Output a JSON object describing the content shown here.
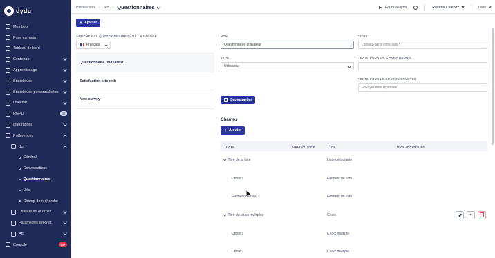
{
  "app": {
    "logo_text": "dydu"
  },
  "sidebar": {
    "items": [
      {
        "label": "Mes bots"
      },
      {
        "label": "Prise en main"
      },
      {
        "label": "Tableau de bord"
      },
      {
        "label": "Contenus"
      },
      {
        "label": "Apprentissage"
      },
      {
        "label": "Statistiques"
      },
      {
        "label": "Statistiques personnalisées"
      },
      {
        "label": "Livechat"
      },
      {
        "label": "RGPD",
        "badge": "38"
      },
      {
        "label": "Intégrations"
      },
      {
        "label": "Préférences"
      },
      {
        "label": "Bot"
      },
      {
        "label": "Général"
      },
      {
        "label": "Conversations"
      },
      {
        "label": "Questionnaires"
      },
      {
        "label": "Urls"
      },
      {
        "label": "Champ de recherche"
      },
      {
        "label": "Utilisateurs et droits"
      },
      {
        "label": "Paramètres livechat"
      },
      {
        "label": "Api"
      },
      {
        "label": "Console",
        "badge": "99+"
      }
    ]
  },
  "topbar": {
    "breadcrumb": [
      "Préférences",
      "Bot",
      "Questionnaires"
    ],
    "send_label": "Écrire à Dydu",
    "bot_label": "Recette Chatbox",
    "user_label": "Lass"
  },
  "left": {
    "add_label": "Ajouter",
    "language_caption": "AFFICHER LE QUESTIONNAIRE DANS LA LANGUE",
    "language_value": "Français",
    "questionnaires": [
      "Questionnaire utilisateur",
      "Satisfaction site web",
      "New survey"
    ]
  },
  "form": {
    "name_caption": "NOM",
    "name_value": "Questionnaire utilisateur",
    "type_caption": "TYPE",
    "type_value": "Utilisateur",
    "title_caption": "TITRE",
    "title_placeholder": "Laissez-nous votre avis !",
    "required_caption": "TEXTE POUR UN CHAMP REQUIS",
    "send_caption": "TEXTE POUR LE BOUTON ENVOYER",
    "send_placeholder": "Envoyer mes réponses",
    "save_label": "Sauvegarder"
  },
  "fields": {
    "title": "Champs",
    "add_label": "Ajouter",
    "columns": [
      "TEXTE",
      "OBLIGATOIRE",
      "TYPE",
      "NON TRADUIT EN"
    ],
    "rows": [
      {
        "text": "Titre de la liste",
        "type": "Liste déroulante"
      },
      {
        "text": "Choix 1",
        "type": "Élément de liste"
      },
      {
        "text": "Élément de liste 2",
        "type": "Élément de liste"
      },
      {
        "text": "Titre du choix multiples",
        "type": "Choix"
      },
      {
        "text": "Choix 1",
        "type": "Choix multiple"
      },
      {
        "text": "Choix 2",
        "type": "Choix multiple"
      }
    ]
  },
  "colors": {
    "sidebar_bg": "#1f2a56",
    "primary": "#2b35a0",
    "danger": "#e2384d"
  }
}
